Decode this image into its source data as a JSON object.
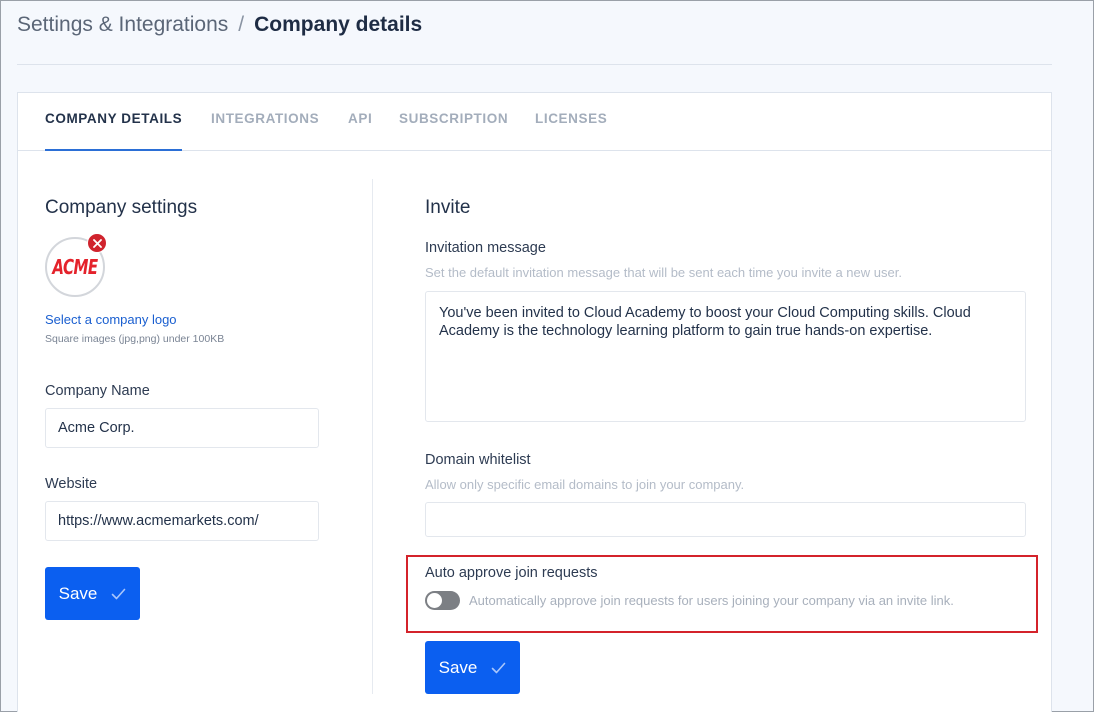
{
  "breadcrumb": {
    "parent": "Settings & Integrations",
    "separator": "/",
    "current": "Company details"
  },
  "tabs": [
    {
      "label": "COMPANY DETAILS",
      "active": true
    },
    {
      "label": "INTEGRATIONS",
      "active": false
    },
    {
      "label": "API",
      "active": false
    },
    {
      "label": "SUBSCRIPTION",
      "active": false
    },
    {
      "label": "LICENSES",
      "active": false
    }
  ],
  "company_settings": {
    "title": "Company settings",
    "logo_text": "ACME",
    "select_logo_label": "Select a company logo",
    "logo_hint": "Square images (jpg,png) under 100KB",
    "company_name_label": "Company Name",
    "company_name_value": "Acme Corp.",
    "website_label": "Website",
    "website_value": "https://www.acmemarkets.com/",
    "save_label": "Save"
  },
  "invite": {
    "title": "Invite",
    "invitation_message_label": "Invitation message",
    "invitation_message_help": "Set the default invitation message that will be sent each time you invite a new user.",
    "invitation_message_value": "You've been invited to Cloud Academy to boost your Cloud Computing skills. Cloud Academy is the technology learning platform to gain true hands-on expertise.",
    "domain_whitelist_label": "Domain whitelist",
    "domain_whitelist_help": "Allow only specific email domains to join your company.",
    "domain_whitelist_value": "",
    "auto_approve_label": "Auto approve join requests",
    "auto_approve_description": "Automatically approve join requests for users joining your company via an invite link.",
    "auto_approve_enabled": false,
    "save_label": "Save"
  },
  "colors": {
    "primary": "#0b5ff0",
    "link": "#1a5fd0",
    "active_tab_underline": "#2b6fd6",
    "highlight": "#d4232b",
    "remove_badge": "#d0232d"
  },
  "icons": {
    "logo_remove": "close-icon",
    "save": "check-icon"
  }
}
